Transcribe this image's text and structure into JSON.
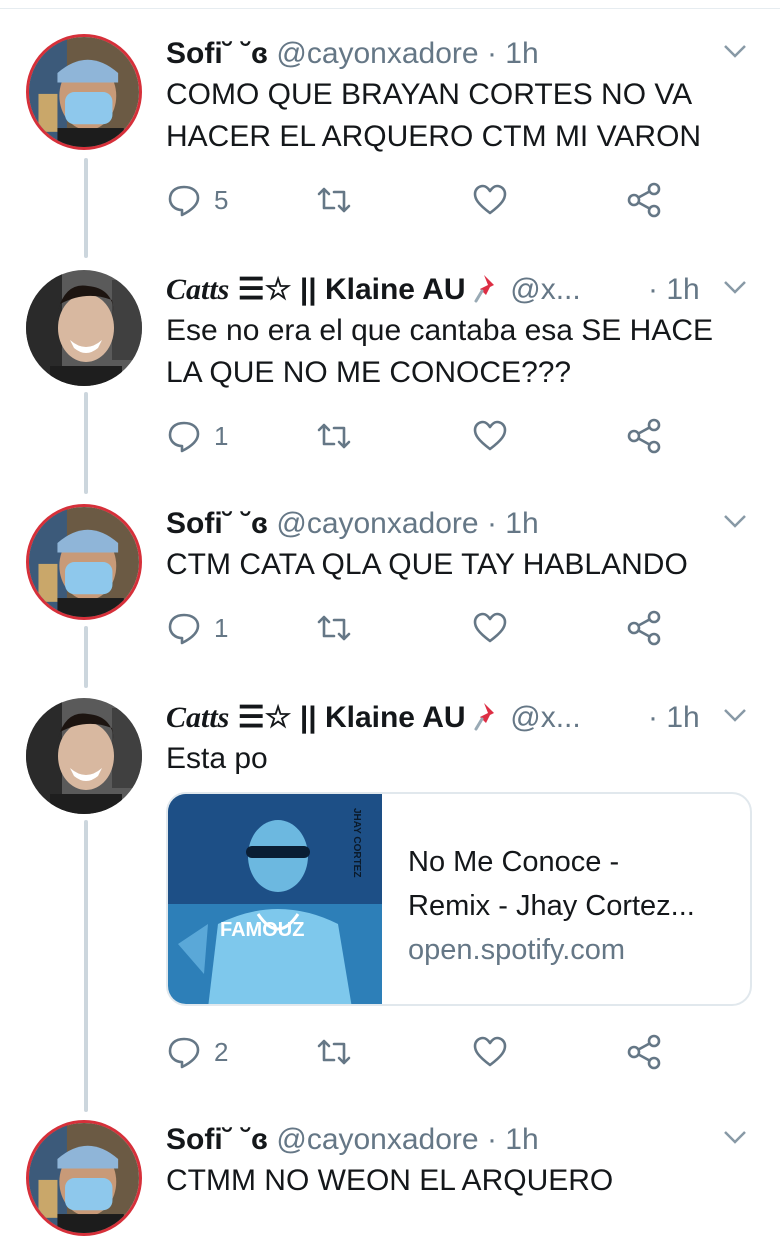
{
  "tweets": [
    {
      "name": "Sofi",
      "name_suffix": "˘ ˘ɞ",
      "handle": "@cayonxadore",
      "time_sep": "·",
      "time": "1h",
      "text_lines": [
        "COMO QUE BRAYAN CORTES NO VA",
        "HACER EL ARQUERO CTM MI VARON"
      ],
      "replies": "5",
      "retweets": "",
      "likes": ""
    },
    {
      "name": "Catts",
      "name_mid": " ☰☆ || ",
      "name_bold": "Klaine AU",
      "handle": "@x...",
      "time_sep": "·",
      "time": "1h",
      "text_lines": [
        "Ese no era el que cantaba esa SE HACE",
        "LA QUE NO ME CONOCE???"
      ],
      "replies": "1"
    },
    {
      "name": "Sofi",
      "name_suffix": "˘ ˘ɞ",
      "handle": "@cayonxadore",
      "time_sep": "·",
      "time": "1h",
      "text_lines": [
        "CTM CATA QLA QUE TAY HABLANDO"
      ],
      "replies": "1"
    },
    {
      "name": "Catts",
      "name_mid": " ☰☆ || ",
      "name_bold": "Klaine AU",
      "handle": "@x...",
      "time_sep": "·",
      "time": "1h",
      "text_lines": [
        "Esta po"
      ],
      "replies": "2",
      "card": {
        "title_line1": "No Me Conoce -",
        "title_line2": "Remix - Jhay Cortez...",
        "domain": "open.spotify.com",
        "art_text": "FAMOUZ",
        "art_side_text": "JHAY CORTEZ"
      }
    },
    {
      "name": "Sofi",
      "name_suffix": "˘ ˘ɞ",
      "handle": "@cayonxadore",
      "time_sep": "·",
      "time": "1h",
      "text_lines": [
        "CTMM NO WEON EL ARQUERO"
      ]
    }
  ],
  "icons": {
    "reply": "reply-icon",
    "retweet": "retweet-icon",
    "like": "heart-icon",
    "share": "share-icon",
    "caret": "chevron-down-icon",
    "pin": "pushpin-icon"
  },
  "colors": {
    "text": "#14171a",
    "secondary": "#657786",
    "thread_line": "#ccd6dd",
    "card_border": "#e1e8ed"
  }
}
